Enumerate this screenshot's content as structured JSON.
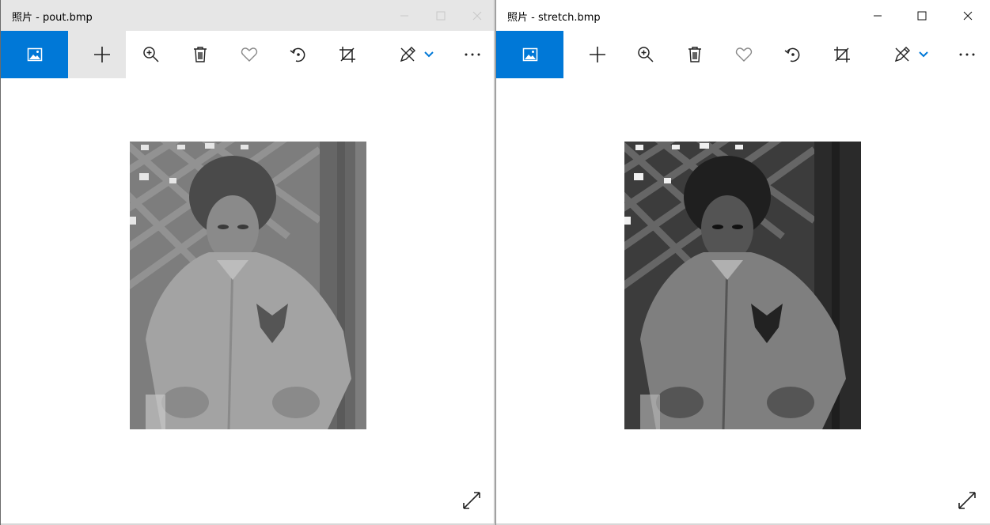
{
  "windows": [
    {
      "title": "照片 - pout.bmp",
      "contrast": "low"
    },
    {
      "title": "照片 - stretch.bmp",
      "contrast": "stretched"
    }
  ],
  "icons": [
    "image-icon",
    "plus-icon",
    "zoom-in-icon",
    "delete-icon",
    "heart-icon",
    "rotate-icon",
    "crop-icon",
    "edit-pen-icon",
    "chevron-down-icon",
    "more-icon",
    "expand-icon",
    "minimize-icon",
    "maximize-icon",
    "close-icon"
  ],
  "colors": {
    "accent": "#0078d7",
    "titlebar_inactive": "#e6e6e6"
  }
}
